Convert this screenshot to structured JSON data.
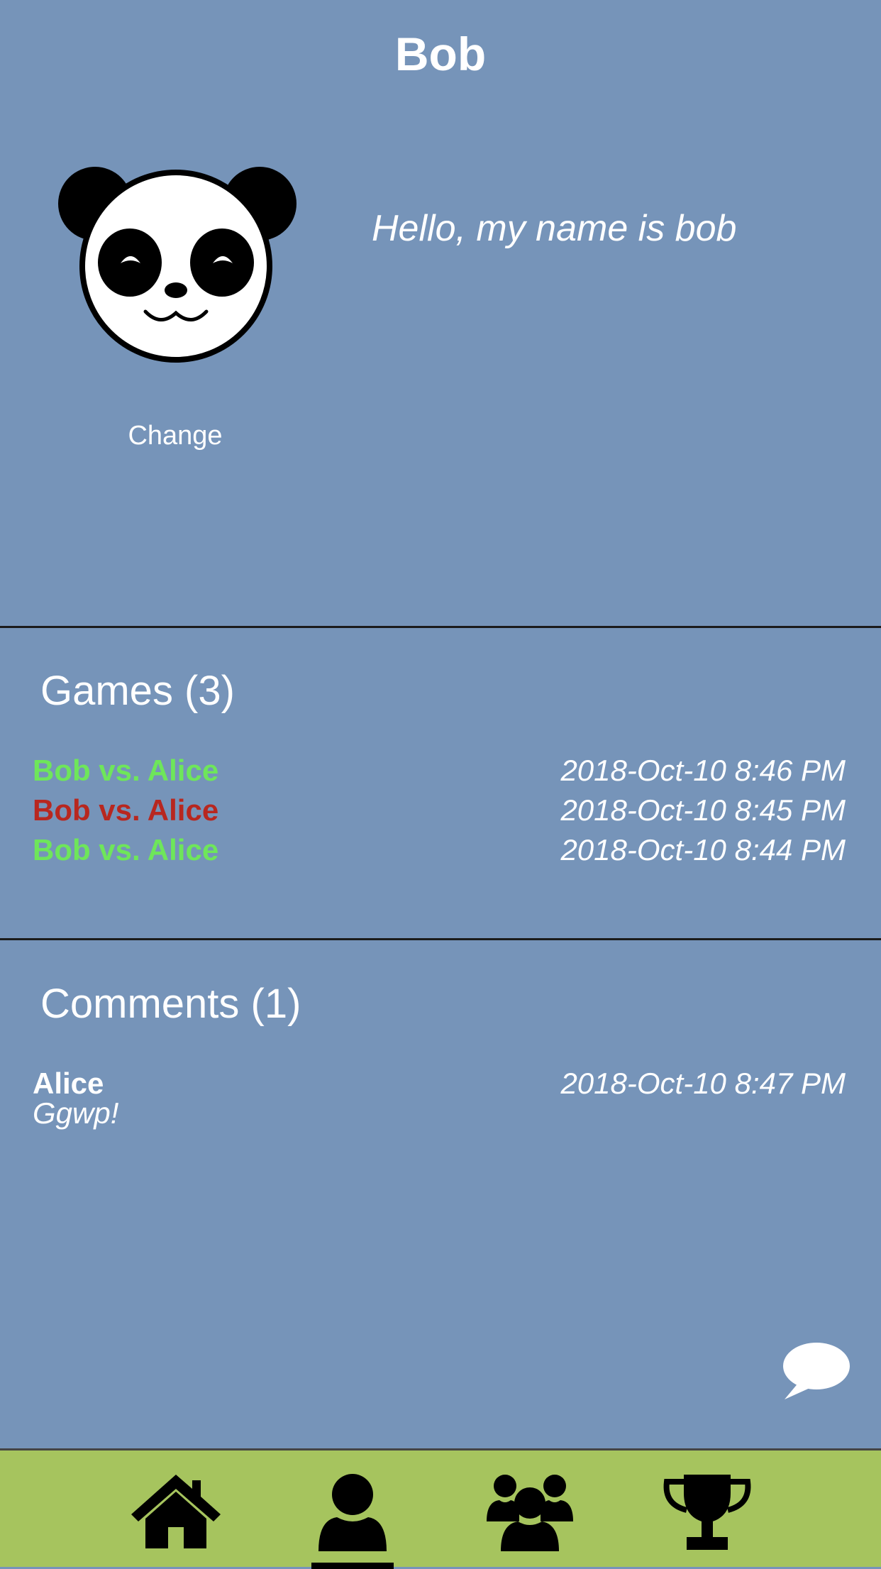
{
  "header": {
    "title": "Bob"
  },
  "profile": {
    "avatar_icon": "panda-avatar",
    "change_label": "Change",
    "bio": "Hello, my name is bob"
  },
  "games": {
    "title": "Games (3)",
    "items": [
      {
        "label": "Bob vs. Alice",
        "time": "2018-Oct-10 8:46 PM",
        "result": "win"
      },
      {
        "label": "Bob vs. Alice",
        "time": "2018-Oct-10 8:45 PM",
        "result": "loss"
      },
      {
        "label": "Bob vs. Alice",
        "time": "2018-Oct-10 8:44 PM",
        "result": "win"
      }
    ]
  },
  "comments": {
    "title": "Comments (1)",
    "items": [
      {
        "author": "Alice",
        "time": "2018-Oct-10 8:47 PM",
        "text": "Ggwp!"
      }
    ]
  },
  "nav": {
    "items": [
      {
        "icon": "home-icon"
      },
      {
        "icon": "user-icon",
        "active": true
      },
      {
        "icon": "group-icon"
      },
      {
        "icon": "trophy-icon"
      }
    ]
  },
  "colors": {
    "background": "#7694b9",
    "win": "#6ee65a",
    "loss": "#b8271f",
    "navbar": "#a6c45e"
  }
}
